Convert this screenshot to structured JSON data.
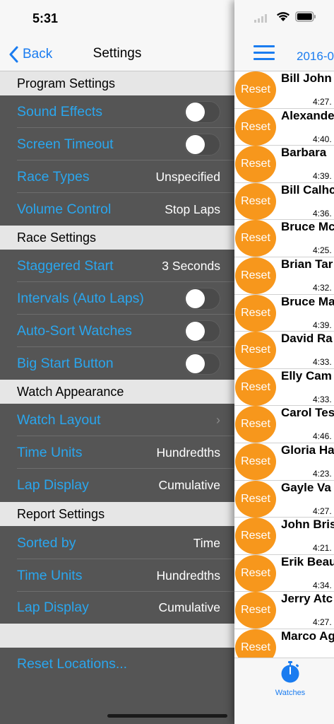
{
  "status": {
    "time": "5:31"
  },
  "nav": {
    "back_label": "Back",
    "title": "Settings"
  },
  "sections": {
    "program": "Program Settings",
    "race": "Race Settings",
    "watch": "Watch Appearance",
    "report": "Report Settings"
  },
  "program_rows": [
    {
      "label": "Sound Effects"
    },
    {
      "label": "Screen Timeout"
    },
    {
      "label": "Race Types",
      "value": "Unspecified"
    },
    {
      "label": "Volume Control",
      "value": "Stop Laps"
    }
  ],
  "race_rows": [
    {
      "label": "Staggered Start",
      "value": "3 Seconds"
    },
    {
      "label": "Intervals (Auto Laps)"
    },
    {
      "label": "Auto-Sort Watches"
    },
    {
      "label": "Big Start Button"
    }
  ],
  "watch_rows": [
    {
      "label": "Watch Layout"
    },
    {
      "label": "Time Units",
      "value": "Hundredths"
    },
    {
      "label": "Lap Display",
      "value": "Cumulative"
    }
  ],
  "report_rows": [
    {
      "label": "Sorted by",
      "value": "Time"
    },
    {
      "label": "Time Units",
      "value": "Hundredths"
    },
    {
      "label": "Lap Display",
      "value": "Cumulative"
    }
  ],
  "reset_locations": "Reset Locations...",
  "watches_panel": {
    "date": "2016-0",
    "reset_label": "Reset",
    "rows": [
      {
        "name": "Bill John",
        "time": "4:27."
      },
      {
        "name": "Alexande",
        "time": "4:40."
      },
      {
        "name": "Barbara",
        "time": "4:39."
      },
      {
        "name": "Bill Calhc",
        "time": "4:36."
      },
      {
        "name": "Bruce Mc",
        "time": "4:25."
      },
      {
        "name": "Brian Tar",
        "time": "4:32."
      },
      {
        "name": "Bruce Ma",
        "time": "4:39."
      },
      {
        "name": "David Ra",
        "time": "4:33."
      },
      {
        "name": "Elly Cam",
        "time": "4:33."
      },
      {
        "name": "Carol Tes",
        "time": "4:46."
      },
      {
        "name": "Gloria Ha",
        "time": "4:23."
      },
      {
        "name": "Gayle Va",
        "time": "4:27."
      },
      {
        "name": "John Bris",
        "time": "4:21."
      },
      {
        "name": "Erik Beau",
        "time": "4:34."
      },
      {
        "name": "Jerry Atc",
        "time": "4:27."
      },
      {
        "name": "Marco Ag",
        "time": ""
      }
    ],
    "tab_label": "Watches"
  },
  "colors": {
    "accent": "#1a7cf0",
    "label_blue": "#2aa6ee",
    "reset_orange": "#f7971c",
    "panel_bg": "#555555"
  }
}
